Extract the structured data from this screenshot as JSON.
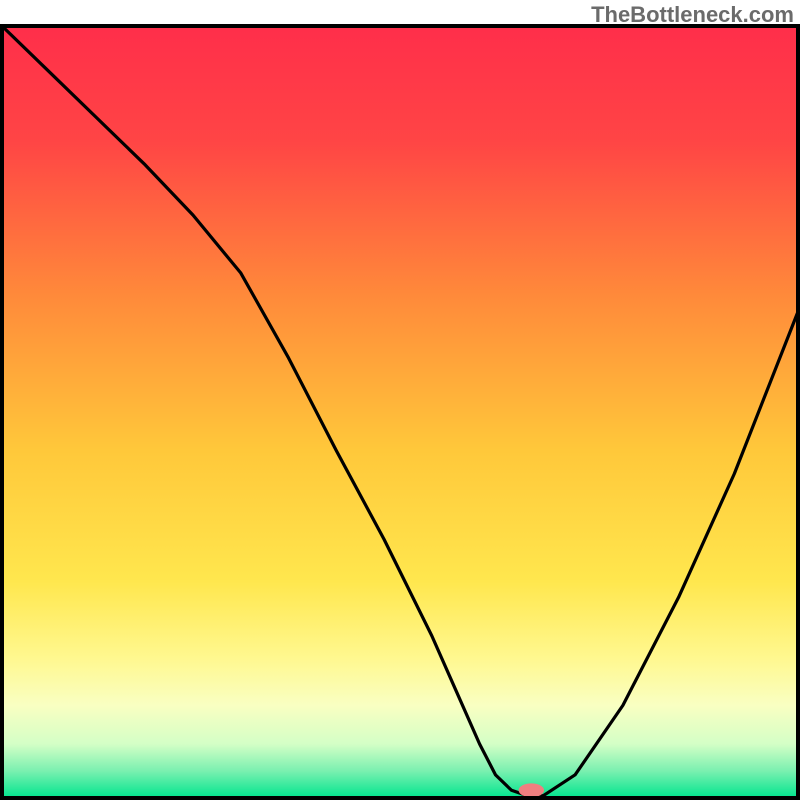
{
  "attribution": "TheBottleneck.com",
  "chart_data": {
    "type": "line",
    "title": "",
    "xlabel": "",
    "ylabel": "",
    "xlim": [
      0,
      100
    ],
    "ylim": [
      0,
      100
    ],
    "series": [
      {
        "name": "curve",
        "x": [
          0,
          6,
          12,
          18,
          24,
          30,
          36,
          42,
          48,
          54,
          57,
          60,
          62,
          64,
          66,
          68,
          72,
          78,
          85,
          92,
          100
        ],
        "y": [
          100,
          94,
          88,
          82,
          75.5,
          68,
          57,
          45,
          33.5,
          21,
          14,
          7,
          3,
          1,
          0.3,
          0.3,
          3,
          12,
          26,
          42,
          63
        ]
      }
    ],
    "marker": {
      "x": 66.5,
      "y": 1.0,
      "rx": 1.6,
      "ry": 0.9,
      "color": "#ef7f80"
    },
    "background_gradient": {
      "stops": [
        {
          "offset": 0.0,
          "color": "#ff2e4a"
        },
        {
          "offset": 0.15,
          "color": "#ff4545"
        },
        {
          "offset": 0.35,
          "color": "#ff8a3a"
        },
        {
          "offset": 0.55,
          "color": "#ffc83a"
        },
        {
          "offset": 0.72,
          "color": "#ffe74e"
        },
        {
          "offset": 0.82,
          "color": "#fff890"
        },
        {
          "offset": 0.88,
          "color": "#f9ffc2"
        },
        {
          "offset": 0.93,
          "color": "#d4ffc6"
        },
        {
          "offset": 0.965,
          "color": "#7af0b0"
        },
        {
          "offset": 1.0,
          "color": "#00e58e"
        }
      ]
    },
    "frame_color": "#000000",
    "frame_width": 4
  }
}
